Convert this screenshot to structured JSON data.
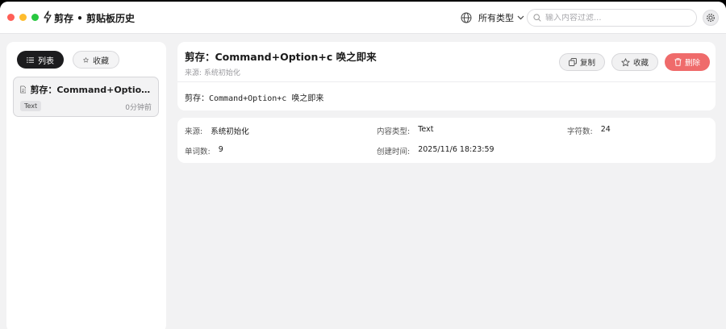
{
  "titlebar": {
    "title": "剪存 • 剪贴板历史",
    "type_filter": "所有类型",
    "search_placeholder": "输入内容过滤...",
    "traffic_lights": {
      "close": "#ff5f57",
      "minimize": "#febc2e",
      "zoom": "#28c840"
    }
  },
  "sidebar": {
    "tabs": [
      {
        "label": "列表",
        "icon": "list-icon",
        "active": true
      },
      {
        "label": "收藏",
        "icon": "star-icon",
        "active": false
      }
    ],
    "items": [
      {
        "title": "剪存：Command+Option+c 唤之即来",
        "type": "Text",
        "time": "0分钟前",
        "icon": "document-icon"
      }
    ]
  },
  "detail": {
    "title": "剪存：Command+Option+c 唤之即来",
    "source": "来源: 系统初始化",
    "content": "剪存：Command+Option+c 唤之即来",
    "buttons": {
      "copy": "复制",
      "favorite": "收藏",
      "delete": "删除"
    },
    "delete_color": "#ef6b6b"
  },
  "meta": {
    "source_label": "来源:",
    "source_value": "系统初始化",
    "type_label": "内容类型:",
    "type_value": "Text",
    "chars_label": "字符数:",
    "chars_value": "24",
    "words_label": "单词数:",
    "words_value": "9",
    "created_label": "创建时间:",
    "created_value": "2025/11/6 18:23:59"
  }
}
